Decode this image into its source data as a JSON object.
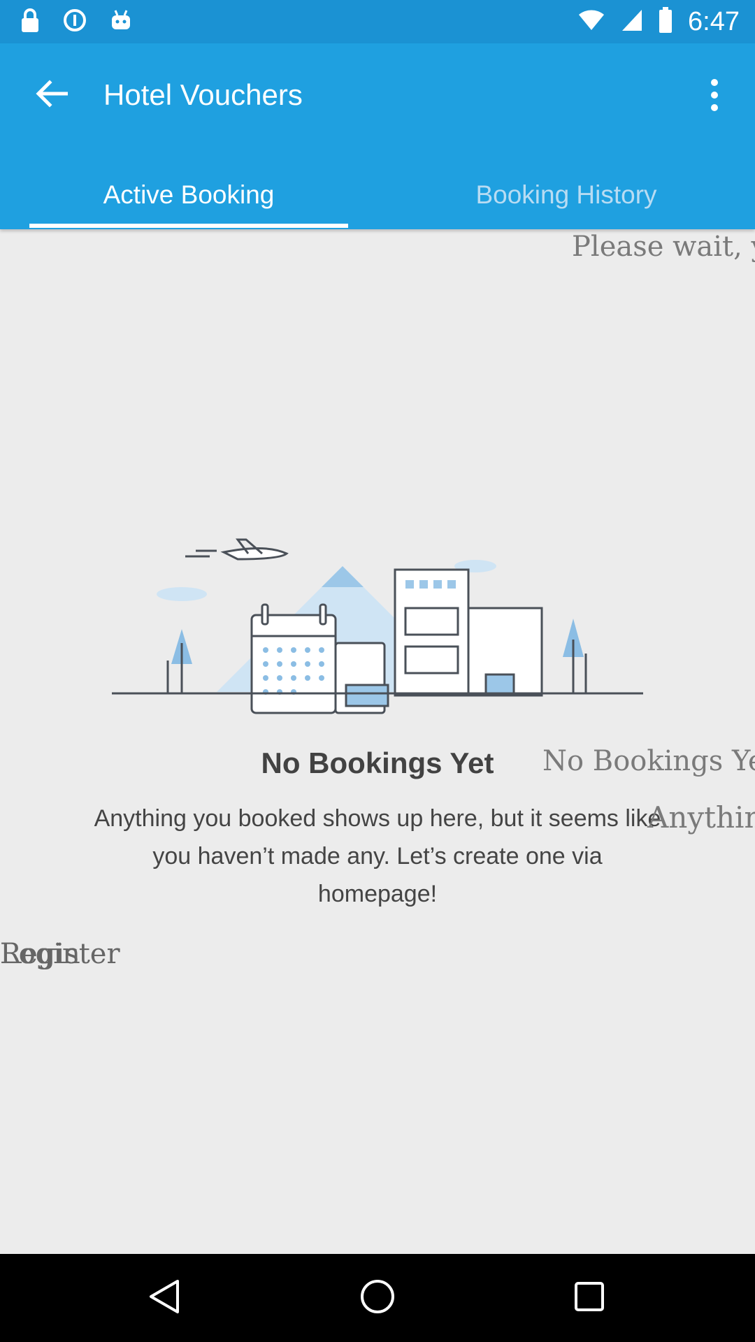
{
  "status_bar": {
    "time": "6:47",
    "icons": [
      "lock-icon",
      "info-icon",
      "android-icon",
      "wifi-icon",
      "signal-icon",
      "battery-icon"
    ]
  },
  "app_bar": {
    "title": "Hotel Vouchers",
    "back_icon": "arrow-back-icon",
    "menu_icon": "more-vert-icon",
    "tabs": [
      {
        "label": "Active Booking",
        "active": true
      },
      {
        "label": "Booking History",
        "active": false
      }
    ],
    "color": "#1fa0e0"
  },
  "content": {
    "please_wait": "Please wait, yo",
    "empty_title": "No Bookings Yet",
    "empty_title_dup": "No Bookings Ye",
    "empty_message": "Anything you booked shows up here, but it seems like you haven’t made any. Let’s create one via homepage!",
    "empty_message_dup": "Anything",
    "overlap_register": "Register",
    "overlap_login": "Login",
    "illustration_icon": "travel-city-illustration"
  },
  "nav_bar": {
    "buttons": [
      "back-triangle-icon",
      "home-circle-icon",
      "recents-square-icon"
    ]
  }
}
